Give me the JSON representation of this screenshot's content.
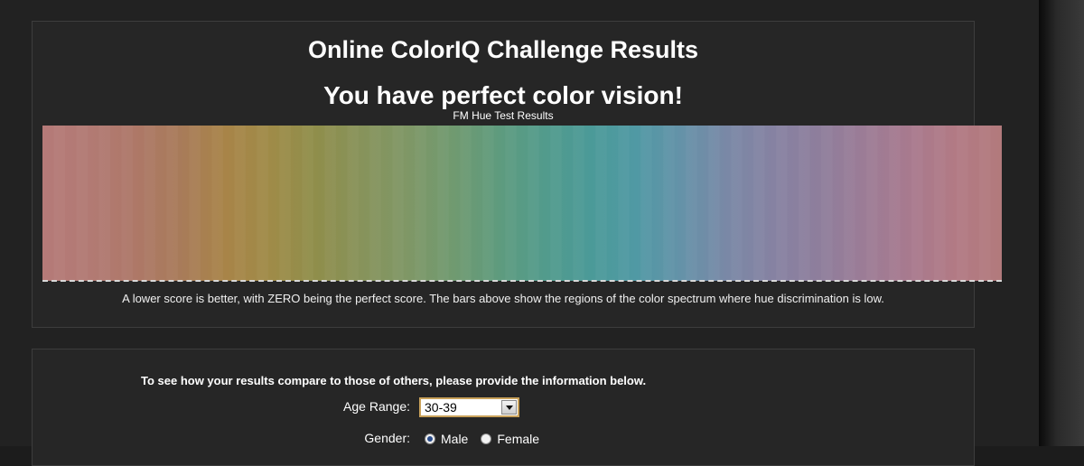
{
  "results": {
    "title": "Online ColorIQ Challenge Results",
    "message": "You have perfect color vision!",
    "chart_title": "FM Hue Test Results",
    "note": "A lower score is better, with ZERO being the perfect score. The bars above show the regions of the color spectrum where hue discrimination is low."
  },
  "chart_data": {
    "type": "bar",
    "title": "FM Hue Test Results",
    "xlabel": "",
    "ylabel": "",
    "note": "No error bars visible — all hue regions score zero",
    "spectrum_colors": [
      "#b57a78",
      "#b27a74",
      "#ae7868",
      "#a87b5a",
      "#a88448",
      "#9f8b48",
      "#8f8e4b",
      "#87935b",
      "#7f9766",
      "#709a70",
      "#5e9b7e",
      "#529b8c",
      "#4b9a98",
      "#5099a4",
      "#6592a8",
      "#7a88a6",
      "#8682a2",
      "#8e7e9c",
      "#9c7c96",
      "#a87a8e",
      "#b27a84",
      "#b27a7c"
    ],
    "values": [
      0,
      0,
      0,
      0,
      0,
      0,
      0,
      0,
      0,
      0,
      0,
      0,
      0,
      0,
      0,
      0,
      0,
      0,
      0,
      0,
      0,
      0
    ]
  },
  "form": {
    "prompt": "To see how your results compare to those of others, please provide the information below.",
    "age_label": "Age Range:",
    "age_value": "30-39",
    "gender_label": "Gender:",
    "gender_options": [
      "Male",
      "Female"
    ],
    "gender_selected": "Male"
  }
}
